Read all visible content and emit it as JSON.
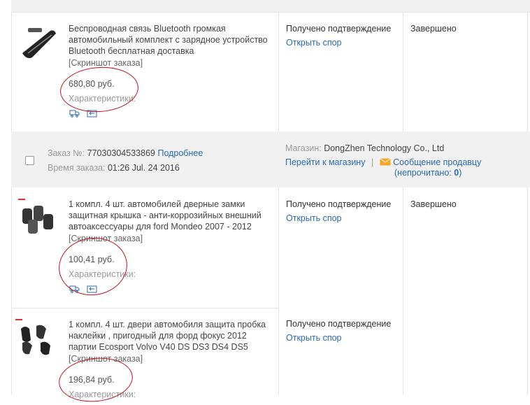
{
  "orders": [
    {
      "items": [
        {
          "title": "Беспроводная связь Bluetooth громкая автомобильный комплект с зарядное устройство Bluetooth бесплатная доставка",
          "snapshot": "[Скриншот заказа]",
          "price": "680,80 руб.",
          "characteristics": "Характеристики:",
          "status": "Получено подтверждение",
          "dispute": "Открыть спор",
          "result": "Завершено"
        }
      ]
    },
    {
      "order_label": "Заказ №:",
      "order_number": "77030304533869",
      "details_link": "Подробнее",
      "time_label": "Время заказа:",
      "time_value": "01:26 Jul. 24 2016",
      "store_label": "Магазин:",
      "store_name": "DongZhen Technology Co., Ltd",
      "go_store": "Перейти к магазину",
      "separator": "|",
      "message_seller": "Сообщение продавцу",
      "unread_open": "(непрочитано:",
      "unread_count": "0",
      "unread_close": ")",
      "items": [
        {
          "title": "1 компл. 4 шт. автомобилей дверные замки защитная крышка - анти-коррозийных внешний автоаксессуары для ford Mondeo 2007 - 2012",
          "snapshot": "[Скриншот заказа]",
          "price": "100,41 руб.",
          "characteristics": "Характеристики:",
          "status": "Получено подтверждение",
          "dispute": "Открыть спор",
          "result": "Завершено"
        },
        {
          "title": "1 компл. 4 шт. двери автомобиля защита пробка наклейки , пригодный для форд фокус 2012 партии Ecosport Volvo V40 DS DS3 DS4 DS5",
          "snapshot": "[Скриншот заказа]",
          "price": "196,84 руб.",
          "characteristics": "Характеристики:",
          "status": "Получено подтверждение",
          "dispute": "Открыть спор"
        }
      ]
    }
  ],
  "colors": {
    "link": "#2a6ab5",
    "header_bg": "#f1f1f1",
    "annotation": "#c0121c"
  }
}
